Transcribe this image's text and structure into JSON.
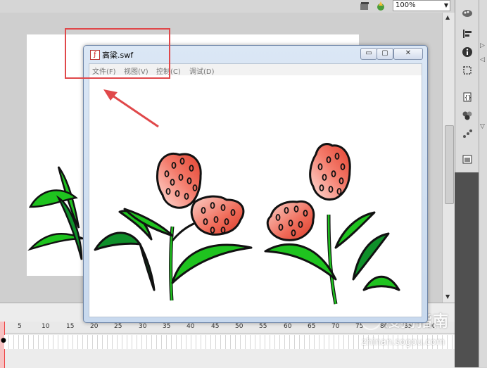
{
  "ide": {
    "zoom": "100%",
    "scene_icon": "edit-scene-icon",
    "symbol_icon": "edit-symbol-icon"
  },
  "swf_window": {
    "title": "高粱.swf",
    "menu": [
      {
        "label": "文件(F)"
      },
      {
        "label": "视图(V)"
      },
      {
        "label": "控制(C)"
      },
      {
        "label": "调试(D)"
      }
    ],
    "buttons": {
      "minimize": "▭",
      "maximize": "▢",
      "close": "✕"
    }
  },
  "timeline": {
    "ticks": [
      "1",
      "5",
      "10",
      "15",
      "20",
      "25",
      "30",
      "35",
      "40",
      "45",
      "50",
      "55",
      "60",
      "65",
      "70",
      "75",
      "80",
      "85",
      "90"
    ],
    "current_frame": "1"
  },
  "tools": [
    "color-swatches-icon",
    "align-icon",
    "info-icon",
    "transform-icon",
    "code-icon",
    "components-icon",
    "motion-icon",
    "library-icon"
  ],
  "watermark": {
    "name": "搜狗指南",
    "url": "zhinan.sogou.com"
  },
  "colors": {
    "annotation": "#e0484a",
    "leaf_light": "#1fc31f",
    "leaf_dark": "#0f8f2a",
    "grain": "#f07a6a"
  }
}
